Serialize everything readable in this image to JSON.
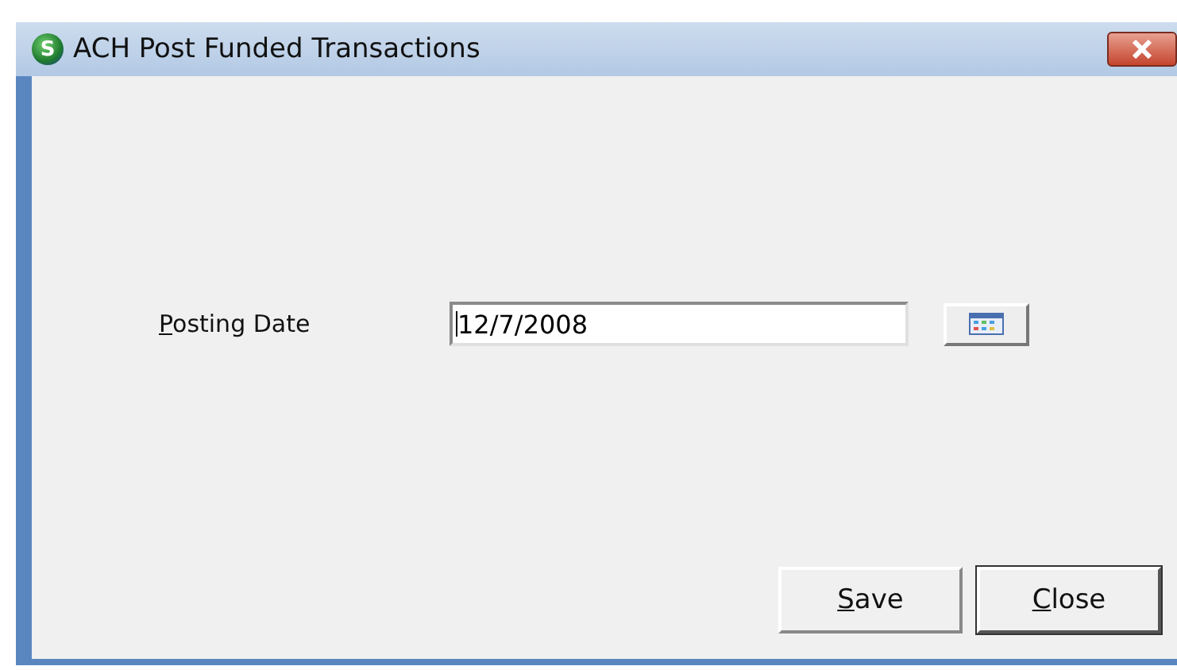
{
  "window": {
    "title": "ACH Post Funded Transactions",
    "app_icon_letter": "S"
  },
  "form": {
    "label": "Posting Date",
    "value": "12/7/2008"
  },
  "buttons": [
    {
      "label": "Save",
      "focused": false
    },
    {
      "label": "Close",
      "focused": true
    }
  ]
}
